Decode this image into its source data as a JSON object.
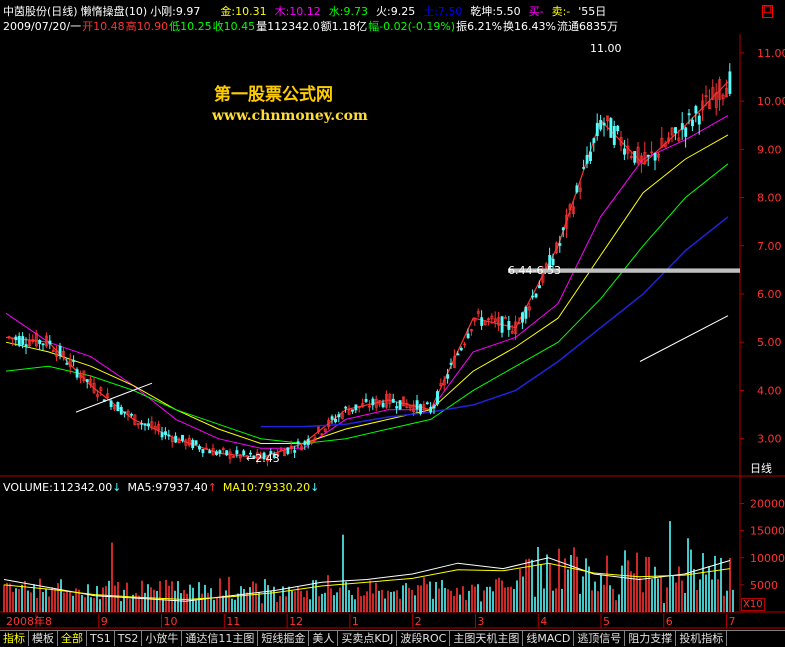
{
  "header": {
    "title": "中茵股份(日线)",
    "indicator": "懒惰操盘(10)",
    "items": [
      {
        "label": "小刚:9.97",
        "color": "#ffffff"
      },
      {
        "label": "金:10.31",
        "color": "#ffff00"
      },
      {
        "label": "木:10.12",
        "color": "#ff00ff"
      },
      {
        "label": "水:9.73",
        "color": "#00ff00"
      },
      {
        "label": "火:9.25",
        "color": "#ffffff"
      },
      {
        "label": "土:7.50",
        "color": "#0000ff"
      },
      {
        "label": "乾坤:5.50",
        "color": "#ffffff"
      },
      {
        "label": "买-",
        "color": "#ff00ff"
      },
      {
        "label": "卖:-",
        "color": "#ffff00"
      },
      {
        "label": "'55日",
        "color": "#ffffff"
      }
    ],
    "corner_box": "口"
  },
  "quote": {
    "date": "2009/07/20/一",
    "open": "开10.48",
    "high": "高10.90",
    "low": "低10.25",
    "close": "收10.45",
    "volume": "量112342.0",
    "amount": "额1.18亿",
    "change": "幅-0.02(-0.19%)",
    "amplitude": "振6.21%",
    "turnover": "换16.43%",
    "float": "流通6835万"
  },
  "watermark": {
    "cn": "第一股票公式网",
    "url": "www.chnmoney.com"
  },
  "annotations": {
    "high_label": "11.00",
    "low_label": "←2.43",
    "range_label": "6.44-6.53",
    "period_label": "日线"
  },
  "volume_header": {
    "volume": "VOLUME:112342.00",
    "ma5": "MA5:97937.40",
    "ma10": "MA10:79330.20"
  },
  "volume_scale_label": "X10",
  "tabs": [
    "指标",
    "模板",
    "全部",
    "TS1",
    "TS2",
    "小放牛",
    "通达信11主图",
    "短线掘金",
    "美人",
    "买卖点KDJ",
    "波段ROC",
    "主图天机主图",
    "线MACD",
    "逃顶信号",
    "阻力支撑",
    "投机指标"
  ],
  "colors": {
    "up": "#ff3232",
    "down": "#54fcfc",
    "ma_white": "#ffffff",
    "ma_yellow": "#ffff00",
    "ma_magenta": "#ff00ff",
    "ma_green": "#00ff00",
    "ma_blue": "#2222dd",
    "axis": "#b00000",
    "cloud": "#ff8040"
  },
  "chart_data": [
    {
      "type": "line",
      "title": "中茵股份(日线)",
      "x": [
        "2008-08",
        "2008-09",
        "2008-10",
        "2008-11",
        "2008-12",
        "2009-01",
        "2009-02",
        "2009-03",
        "2009-04",
        "2009-05",
        "2009-06",
        "2009-07"
      ],
      "xtick_labels": [
        "8",
        "9",
        "10",
        "11",
        "12",
        "1",
        "2",
        "3",
        "4",
        "5",
        "6",
        "7"
      ],
      "xtick_first_prefix": "2008年",
      "yticks": [
        "3.00",
        "4.00",
        "5.00",
        "6.00",
        "7.00",
        "8.00",
        "9.00",
        "10.00",
        "11.00"
      ],
      "ylim": [
        2.35,
        11.35
      ],
      "series": [
        {
          "values": [
            5.1,
            5.0,
            4.1,
            3.4,
            3.0,
            2.7,
            2.6,
            2.9,
            3.6,
            3.8,
            3.6,
            5.5,
            5.3,
            7.0,
            9.6,
            8.7,
            9.5,
            10.4
          ]
        },
        {
          "values": [
            5.6,
            5.0,
            4.7,
            4.1,
            3.4,
            3.0,
            2.8,
            2.8,
            3.4,
            3.6,
            3.6,
            4.8,
            5.1,
            5.8,
            7.6,
            8.8,
            9.2,
            9.7
          ]
        },
        {
          "values": [
            5.0,
            4.8,
            4.5,
            4.1,
            3.6,
            3.2,
            2.9,
            2.9,
            3.2,
            3.4,
            3.6,
            4.4,
            4.9,
            5.5,
            6.8,
            8.1,
            8.8,
            9.3
          ]
        },
        {
          "values": [
            4.4,
            4.5,
            4.3,
            4.0,
            3.6,
            3.3,
            3.0,
            2.9,
            3.0,
            3.2,
            3.4,
            4.0,
            4.5,
            5.0,
            5.9,
            7.0,
            8.0,
            8.7
          ]
        },
        {
          "values": [
            null,
            null,
            null,
            null,
            null,
            null,
            3.25,
            3.25,
            3.3,
            3.45,
            3.55,
            3.7,
            4.0,
            4.6,
            5.3,
            6.0,
            6.9,
            7.6
          ]
        }
      ],
      "annotations": [
        "11.00",
        "←2.43",
        "6.44-6.53"
      ]
    },
    {
      "type": "bar",
      "title": "VOLUME",
      "yticks": [
        "5000",
        "10000",
        "15000",
        "20000"
      ],
      "ylim": [
        0,
        22500
      ],
      "unit_label": "X10",
      "series": [
        {
          "name": "MA5",
          "values": [
            6000,
            4500,
            3000,
            2500,
            2000,
            3000,
            4000,
            5500,
            6000,
            7000,
            9000,
            8000,
            10000,
            7000,
            6000,
            7000,
            9500
          ]
        },
        {
          "name": "MA10",
          "values": [
            5000,
            4200,
            3200,
            2700,
            2300,
            2800,
            3600,
            4800,
            5500,
            6200,
            7800,
            7600,
            9000,
            7200,
            6500,
            6800,
            8000
          ]
        }
      ],
      "latest": {
        "volume": 112342.0,
        "ma5": 97937.4,
        "ma10": 79330.2
      }
    }
  ]
}
